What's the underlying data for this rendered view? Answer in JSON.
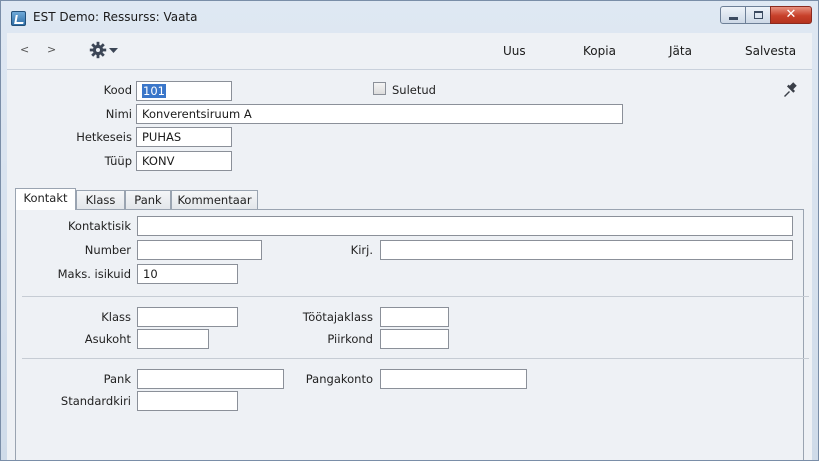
{
  "window": {
    "title": "EST Demo: Ressurss: Vaata",
    "controls": {
      "minimize": "minimize",
      "maximize": "maximize",
      "close": "✕"
    }
  },
  "toolbar": {
    "back": "<",
    "forward": ">",
    "new_label": "Uus",
    "copy_label": "Kopia",
    "skip_label": "Jäta",
    "save_label": "Salvesta"
  },
  "header": {
    "kood_label": "Kood",
    "kood_value": "101",
    "suletud_label": "Suletud",
    "suletud_checked": false,
    "nimi_label": "Nimi",
    "nimi_value": "Konverentsiruum A",
    "hetkeseis_label": "Hetkeseis",
    "hetkeseis_value": "PUHAS",
    "tyyp_label": "Tüüp",
    "tyyp_value": "KONV"
  },
  "tabs": [
    {
      "label": "Kontakt",
      "active": true
    },
    {
      "label": "Klass",
      "active": false
    },
    {
      "label": "Pank",
      "active": false
    },
    {
      "label": "Kommentaar",
      "active": false
    }
  ],
  "kontakt": {
    "kontaktisik_label": "Kontaktisik",
    "kontaktisik_value": "",
    "number_label": "Number",
    "number_value": "",
    "kirj_label": "Kirj.",
    "kirj_value": "",
    "maks_label": "Maks. isikuid",
    "maks_value": "10"
  },
  "klass": {
    "klass_label": "Klass",
    "klass_value": "",
    "tootajaklass_label": "Töötajaklass",
    "tootajaklass_value": "",
    "asukoht_label": "Asukoht",
    "asukoht_value": "",
    "piirkond_label": "Piirkond",
    "piirkond_value": ""
  },
  "pank": {
    "pank_label": "Pank",
    "pank_value": "",
    "pangakonto_label": "Pangakonto",
    "pangakonto_value": "",
    "standardkiri_label": "Standardkiri",
    "standardkiri_value": ""
  },
  "icons": [
    "app-icon",
    "gear-icon",
    "chevron-down-icon",
    "pin-icon"
  ],
  "colors": {
    "selection": "#3a76c9",
    "close_button": "#c7402a"
  }
}
